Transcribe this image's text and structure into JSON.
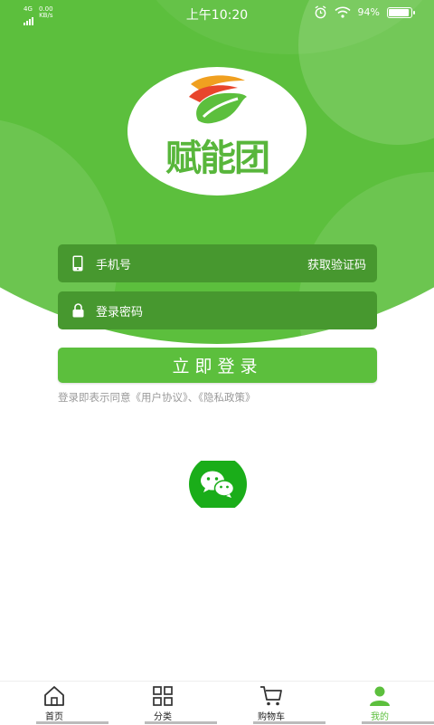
{
  "status_bar": {
    "network": "4G",
    "speed_value": "0.00",
    "speed_unit": "KB/s",
    "time": "上午10:20",
    "battery": "94%",
    "battery_level": 0.94
  },
  "brand": {
    "name": "赋能团"
  },
  "form": {
    "phone_label": "手机号",
    "get_code_label": "获取验证码",
    "password_label": "登录密码",
    "login_button": "立即登录",
    "agreement_text": "登录即表示同意《用户协议》、《隐私政策》"
  },
  "tabbar": {
    "items": [
      {
        "label": "首页",
        "icon": "home-icon",
        "active": false
      },
      {
        "label": "分类",
        "icon": "grid-icon",
        "active": false
      },
      {
        "label": "购物车",
        "icon": "cart-icon",
        "active": false
      },
      {
        "label": "我的",
        "icon": "person-icon",
        "active": true
      }
    ]
  },
  "colors": {
    "primary_green": "#5cbf3d",
    "field_green": "#47982f",
    "wechat_green": "#1aad19"
  }
}
